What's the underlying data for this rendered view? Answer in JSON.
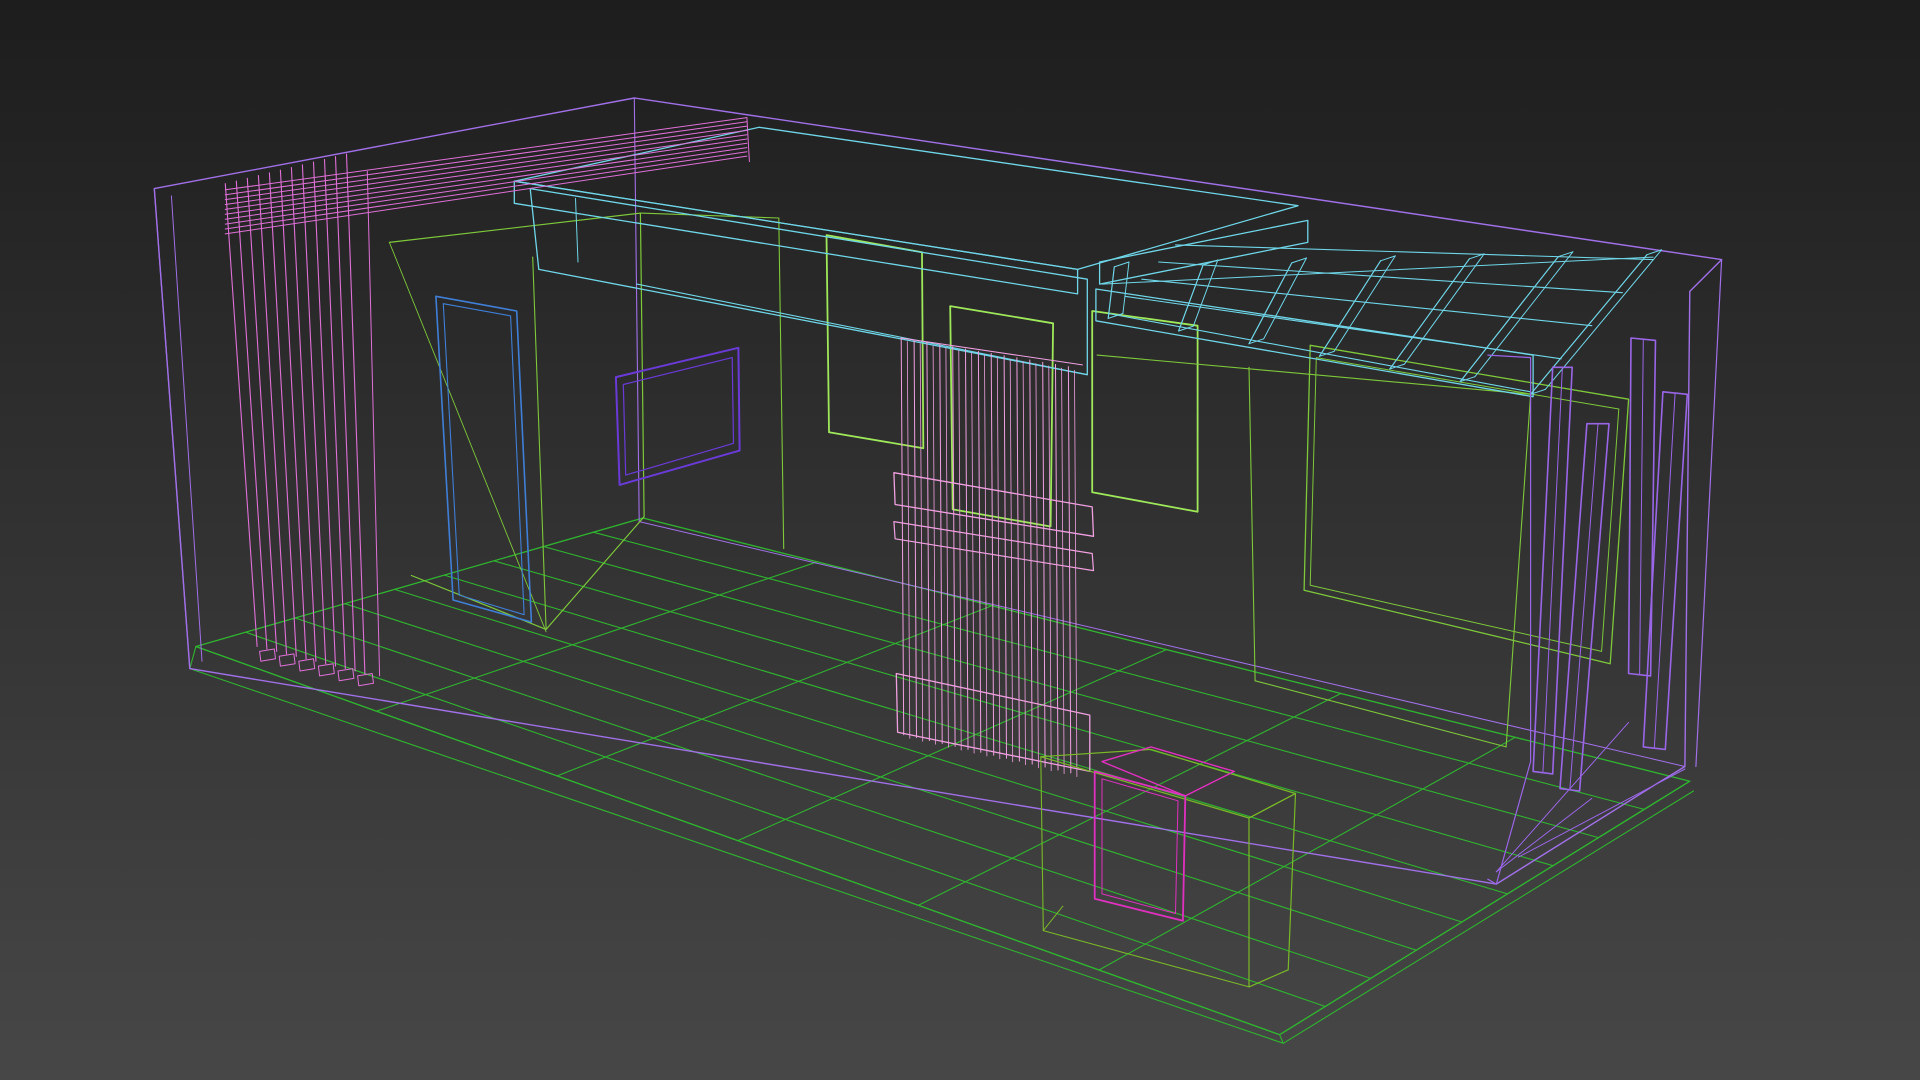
{
  "viewport": {
    "view": "perspective",
    "shading": "wireframe"
  },
  "colors": {
    "background_top": "#1d1d1d",
    "background_bottom": "#474747",
    "room_shell": "#a070e8",
    "floor_tiles": "#2fb52f",
    "walls_inner": "#7ec83a",
    "soffit_beams": "#6fd6e8",
    "curtain": "#e070d8",
    "door": "#3f7fd8",
    "picture_frame": "#6a3ad8",
    "panels": "#9ee85a",
    "slat_screen": "#f0a0e0",
    "cabinet_magenta": "#e030c0",
    "cabinet_green": "#7ab828",
    "columns": "#9a66e8"
  },
  "objects": [
    {
      "name": "room-shell",
      "color_key": "room_shell"
    },
    {
      "name": "floor-grid",
      "color_key": "floor_tiles"
    },
    {
      "name": "inner-walls",
      "color_key": "walls_inner"
    },
    {
      "name": "ceiling-soffit",
      "color_key": "soffit_beams"
    },
    {
      "name": "ceiling-slat-grid",
      "color_key": "soffit_beams"
    },
    {
      "name": "left-curtain",
      "color_key": "curtain"
    },
    {
      "name": "wall-door",
      "color_key": "door"
    },
    {
      "name": "wall-picture",
      "color_key": "picture_frame"
    },
    {
      "name": "wall-panels",
      "color_key": "panels"
    },
    {
      "name": "slat-screen",
      "color_key": "slat_screen"
    },
    {
      "name": "floor-cabinet",
      "color_key": "cabinet_green"
    },
    {
      "name": "cabinet-panel",
      "color_key": "cabinet_magenta"
    },
    {
      "name": "right-columns",
      "color_key": "columns"
    },
    {
      "name": "right-wall-frame",
      "color_key": "walls_inner"
    }
  ]
}
